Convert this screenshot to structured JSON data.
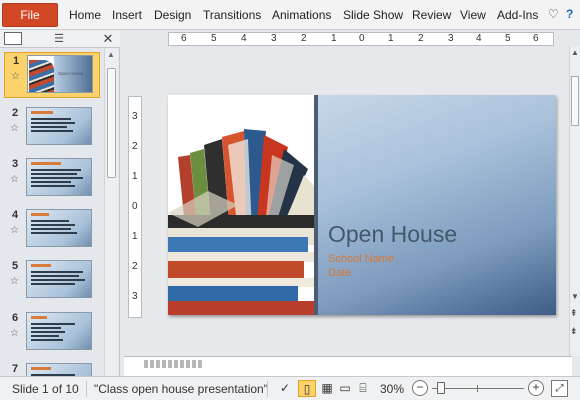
{
  "ribbon": {
    "file_label": "File",
    "tabs": [
      "Home",
      "Insert",
      "Design",
      "Transitions",
      "Animations",
      "Slide Show",
      "Review",
      "View",
      "Add-Ins"
    ]
  },
  "thumbnails": {
    "numbers": [
      "1",
      "2",
      "3",
      "4",
      "5",
      "6",
      "7"
    ],
    "first_title": "Open House"
  },
  "ruler": {
    "h_labels": [
      "6",
      "5",
      "4",
      "3",
      "2",
      "1",
      "0",
      "1",
      "2",
      "3",
      "4",
      "5",
      "6"
    ],
    "v_labels": [
      "3",
      "2",
      "1",
      "0",
      "1",
      "2",
      "3"
    ]
  },
  "slide": {
    "title": "Open House",
    "subtitle_line1": "School Name",
    "subtitle_line2": "Date",
    "accent_color": "#d9772f",
    "title_color": "#44586c"
  },
  "status": {
    "slide_info": "Slide 1 of 10",
    "theme_name": "\"Class open house presentation\"",
    "zoom": "30%"
  },
  "icons": {
    "collapse_ribbon": "chevron-up-icon",
    "help": "help-icon",
    "close_pane": "close-icon"
  }
}
